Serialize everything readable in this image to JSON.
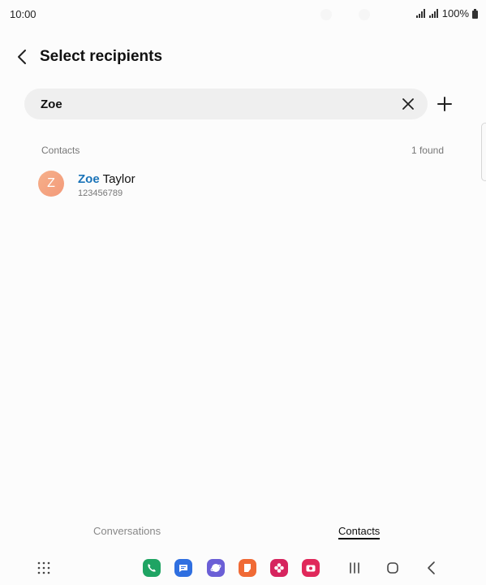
{
  "status_bar": {
    "time": "10:00",
    "battery": "100%",
    "icons": [
      "signal-icon",
      "signal-icon",
      "battery-icon"
    ]
  },
  "header": {
    "title": "Select recipients",
    "back_icon": "chevron-left-icon"
  },
  "search": {
    "value": "Zoe",
    "placeholder": "",
    "clear_icon": "close-icon",
    "add_icon": "plus-icon"
  },
  "results": {
    "section_label": "Contacts",
    "found_label": "1 found",
    "items": [
      {
        "avatar_letter": "Z",
        "name_match": "Zoe",
        "name_rest": " Taylor",
        "number": "123456789"
      }
    ]
  },
  "tabs": [
    {
      "label": "Conversations",
      "active": false
    },
    {
      "label": "Contacts",
      "active": true
    }
  ],
  "dock": {
    "apps_icon": "apps-grid-icon",
    "apps": [
      {
        "icon": "phone-icon",
        "color": "#1fa463"
      },
      {
        "icon": "messages-icon",
        "color": "#2f6fe0"
      },
      {
        "icon": "internet-icon",
        "color": "#6b5fd6"
      },
      {
        "icon": "notes-icon",
        "color": "#f06a35"
      },
      {
        "icon": "gallery-icon",
        "color": "#d6245e"
      },
      {
        "icon": "camera-icon",
        "color": "#e0285a"
      }
    ]
  },
  "colors": {
    "accent": "#1a73b8",
    "search_bg": "#efefef",
    "avatar": "#f4a582"
  }
}
